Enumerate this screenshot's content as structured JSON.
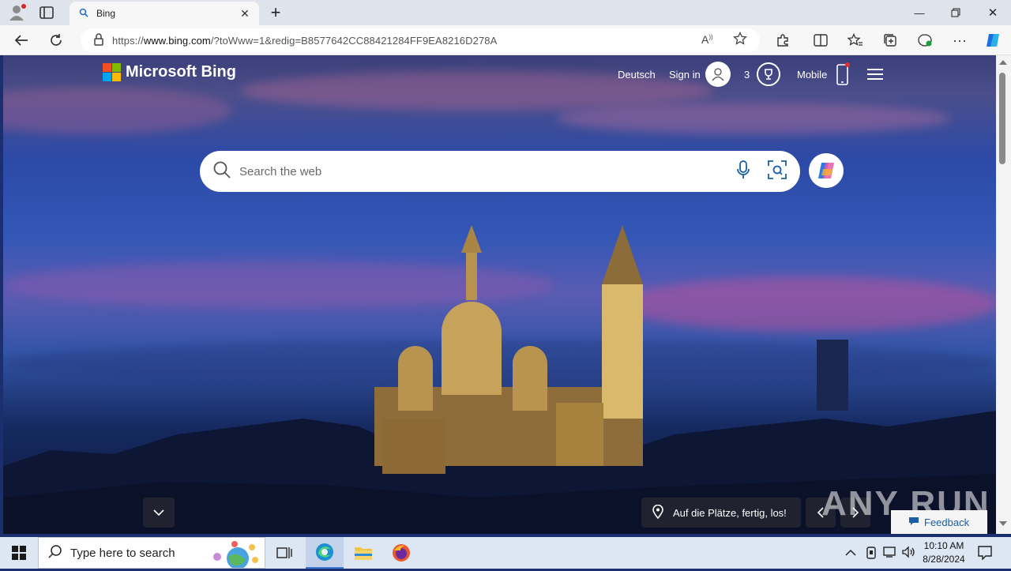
{
  "browser": {
    "tab_title": "Bing",
    "url_prefix": "https://",
    "url_host": "www.bing.com",
    "url_rest": "/?toWww=1&redig=B8577642CC88421284FF9EA8216D278A"
  },
  "bing": {
    "brand": "Microsoft Bing",
    "language_link": "Deutsch",
    "sign_in": "Sign in",
    "rewards_count": "3",
    "mobile": "Mobile",
    "search_placeholder": "Search the web",
    "caption": "Auf die Plätze, fertig, los!",
    "feedback": "Feedback",
    "watermark": "ANY RUN"
  },
  "taskbar": {
    "search_placeholder": "Type here to search",
    "time": "10:10 AM",
    "date": "8/28/2024"
  },
  "colors": {
    "logo": [
      "#f25022",
      "#7fba00",
      "#00a4ef",
      "#ffb900"
    ],
    "accent": "#0078d4"
  }
}
